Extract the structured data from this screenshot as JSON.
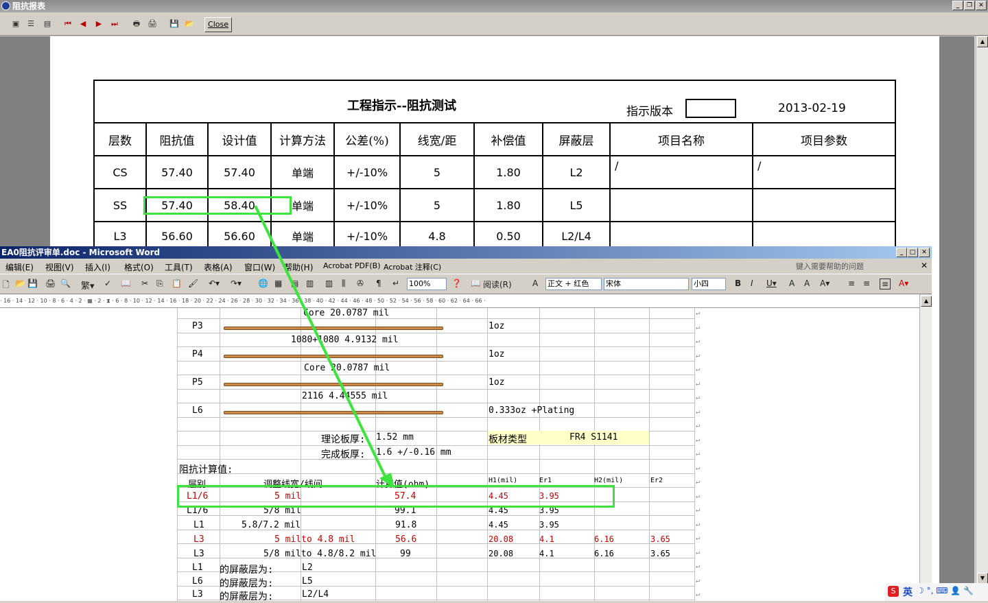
{
  "report_window": {
    "title": "阻抗报表",
    "close_label": "Close",
    "header": {
      "title": "工程指示--阻抗测试",
      "version_label": "指示版本",
      "date": "2013-02-19"
    },
    "columns": [
      "层数",
      "阻抗值",
      "设计值",
      "计算方法",
      "公差(%)",
      "线宽/距",
      "补偿值",
      "屏蔽层",
      "项目名称",
      "项目参数"
    ],
    "rows": [
      [
        "CS",
        "57.40",
        "57.40",
        "单端",
        "+/-10%",
        "5",
        "1.80",
        "L2",
        "/",
        "/"
      ],
      [
        "SS",
        "57.40",
        "58.40",
        "单端",
        "+/-10%",
        "5",
        "1.80",
        "L5",
        "",
        ""
      ],
      [
        "L3",
        "56.60",
        "56.60",
        "单端",
        "+/-10%",
        "4.8",
        "0.50",
        "L2/L4",
        "",
        ""
      ]
    ]
  },
  "word_window": {
    "title": "EA0阻抗评审单.doc - Microsoft Word",
    "menu": [
      "编辑(E)",
      "视图(V)",
      "插入(I)",
      "格式(O)",
      "工具(T)",
      "表格(A)",
      "窗口(W)",
      "帮助(H)",
      "Acrobat PDF(B)",
      "Acrobat 注释(C)"
    ],
    "help_placeholder": "键入需要帮助的问题",
    "zoom": "100%",
    "read_label": "阅读(R)",
    "style": "正文 + 红色",
    "font": "宋体",
    "size": "小四",
    "stack": [
      {
        "layer": "",
        "desc": "Core   20.0787 mil",
        "cu": ""
      },
      {
        "layer": "P3",
        "desc": "",
        "cu": "1oz"
      },
      {
        "layer": "",
        "desc": "1080+1080    4.9132 mil",
        "cu": ""
      },
      {
        "layer": "P4",
        "desc": "",
        "cu": "1oz"
      },
      {
        "layer": "",
        "desc": "Core  20.0787 mil",
        "cu": ""
      },
      {
        "layer": "P5",
        "desc": "",
        "cu": "1oz"
      },
      {
        "layer": "",
        "desc": "2116     4.44555 mil",
        "cu": ""
      },
      {
        "layer": "L6",
        "desc": "",
        "cu": "0.333oz +Plating"
      }
    ],
    "theory_label": "理论板厚:",
    "theory_value": "1.52 mm",
    "board_type_label": "板材类型",
    "board_type_value": "FR4 S1141",
    "finish_label": "完成板厚:",
    "finish_value": "1.6 +/-0.16 mm",
    "calc_label": "阻抗计算值:",
    "calc_headers": [
      "层别",
      "调整线宽/线间",
      "计算值(ohm)",
      "H1(mil)",
      "Er1",
      "H2(mil)",
      "Er2"
    ],
    "calc_rows": [
      [
        "L1/6",
        "5 mil",
        "57.4",
        "4.45",
        "3.95",
        "",
        ""
      ],
      [
        "L1/6",
        "5/8 mil",
        "99.1",
        "4.45",
        "3.95",
        "",
        ""
      ],
      [
        "L1",
        "5.8/7.2 mil",
        "91.8",
        "4.45",
        "3.95",
        "",
        ""
      ],
      [
        "L3",
        "5 milto 4.8 mil",
        "56.6",
        "20.08",
        "4.1",
        "6.16",
        "3.65"
      ],
      [
        "L3",
        "5/8 milto 4.8/8.2 mil",
        "99",
        "20.08",
        "4.1",
        "6.16",
        "3.65"
      ]
    ],
    "shield_rows": [
      [
        "L1",
        "的屏蔽层为:",
        "L2"
      ],
      [
        "L6",
        "的屏蔽层为:",
        "L5"
      ],
      [
        "L3",
        "的屏蔽层为:",
        "L2/L4"
      ]
    ]
  },
  "tray": {
    "ime": "英"
  }
}
